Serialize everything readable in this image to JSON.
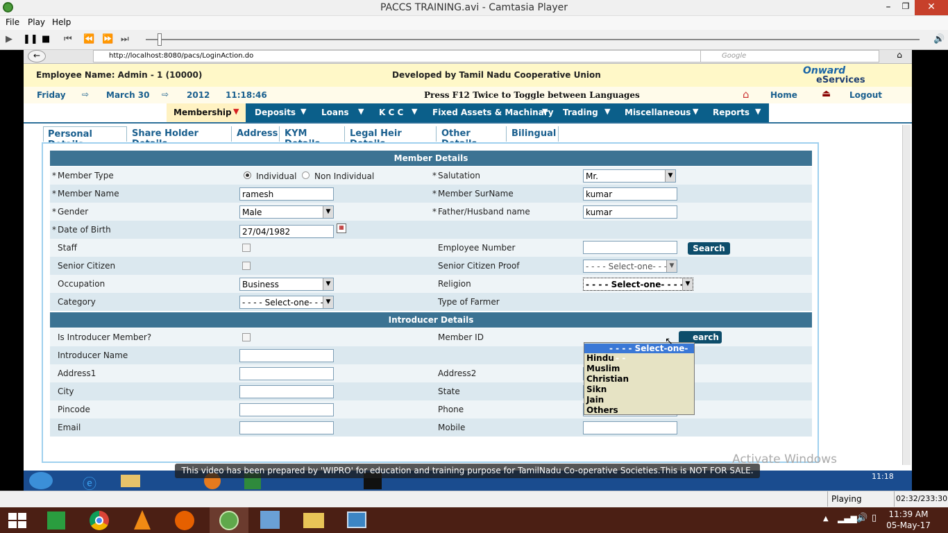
{
  "window": {
    "title": "PACCS TRAINING.avi - Camtasia Player"
  },
  "menu": {
    "file": "File",
    "play": "Play",
    "help": "Help"
  },
  "browser": {
    "url": "http://localhost:8080/pacs/LoginAction.do",
    "search_placeholder": "Google"
  },
  "header": {
    "employee": "Employee Name: Admin - 1  (10000)",
    "developer": "Developed by Tamil Nadu Cooperative Union",
    "logo_top": "Onward",
    "logo_bottom": "eServices",
    "day": "Friday",
    "date": "March 30",
    "year": "2012",
    "time": "11:18:46",
    "notice": "Press F12 Twice to Toggle between Languages",
    "home": "Home",
    "logout": "Logout"
  },
  "nav": [
    {
      "label": "Membership"
    },
    {
      "label": "Deposits"
    },
    {
      "label": "Loans"
    },
    {
      "label": "K C C"
    },
    {
      "label": "Fixed Assets & Machinary"
    },
    {
      "label": "Trading"
    },
    {
      "label": "Miscellaneous"
    },
    {
      "label": "Reports"
    }
  ],
  "tabs": [
    "Personal Details",
    "Share Holder Details",
    "Address",
    "KYM Details",
    "Legal Heir Details",
    "Other Details",
    "Bilingual"
  ],
  "member": {
    "section_title": "Member Details",
    "member_type_label": "Member Type",
    "individual": "Individual",
    "non_individual": "Non Individual",
    "salutation_label": "Salutation",
    "salutation_value": "Mr.",
    "member_name_label": "Member Name",
    "member_name_value": "ramesh",
    "surname_label": "Member SurName",
    "surname_value": "kumar",
    "gender_label": "Gender",
    "gender_value": "Male",
    "father_label": "Father/Husband name",
    "father_value": "kumar",
    "dob_label": "Date of Birth",
    "dob_value": "27/04/1982",
    "staff_label": "Staff",
    "employee_number_label": "Employee Number",
    "search": "Search",
    "senior_label": "Senior Citizen",
    "senior_proof_label": "Senior Citizen Proof",
    "senior_proof_value": "- - - - Select-one- - - -",
    "occupation_label": "Occupation",
    "occupation_value": "Business",
    "religion_label": "Religion",
    "religion_value": "- - - - Select-one- - - -",
    "category_label": "Category",
    "category_value": "- - - - Select-one- - - -",
    "farmer_label": "Type of Farmer"
  },
  "religion_options": [
    "- - - - Select-one- - - -",
    "Hindu",
    "Muslim",
    "Christian",
    "Sikn",
    "Jain",
    "Others"
  ],
  "introducer": {
    "section_title": "Introducer Details",
    "is_introducer_label": "Is Introducer Member?",
    "member_id_label": "Member ID",
    "search_partial": "earch",
    "introducer_name_label": "Introducer Name",
    "address1_label": "Address1",
    "address2_label": "Address2",
    "city_label": "City",
    "state_label": "State",
    "pincode_label": "Pincode",
    "phone_label": "Phone",
    "email_label": "Email",
    "mobile_label": "Mobile"
  },
  "overlay": {
    "caption": "This video has been prepared by 'WIPRO' for education and training purpose for TamilNadu Co-operative Societies.This is NOT FOR SALE.",
    "watermark": "Activate Windows",
    "inner_time": "11:18"
  },
  "status": {
    "state": "Playing",
    "position": "02:32/233:30"
  },
  "taskbar": {
    "time": "11:39 AM",
    "date": "05-May-17"
  },
  "colors": {
    "nav_bg": "#0b5f8a",
    "section_bg": "#3c7393",
    "header_bg": "#fff8c8",
    "taskbar_bg": "#4b1f14"
  }
}
